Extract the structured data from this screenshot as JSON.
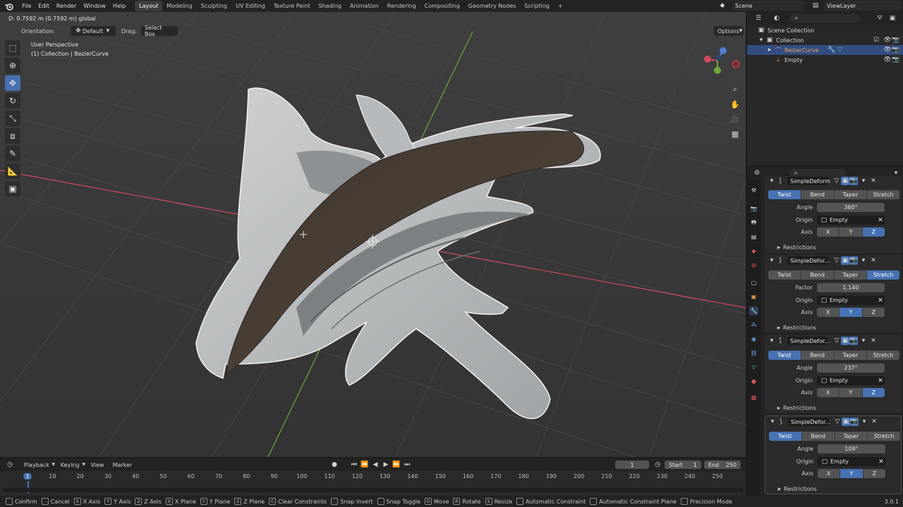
{
  "menu": [
    "File",
    "Edit",
    "Render",
    "Window",
    "Help"
  ],
  "workspaces": [
    {
      "label": "Layout",
      "active": true
    },
    {
      "label": "Modeling",
      "active": false
    },
    {
      "label": "Sculpting",
      "active": false
    },
    {
      "label": "UV Editing",
      "active": false
    },
    {
      "label": "Texture Paint",
      "active": false
    },
    {
      "label": "Shading",
      "active": false
    },
    {
      "label": "Animation",
      "active": false
    },
    {
      "label": "Rendering",
      "active": false
    },
    {
      "label": "Compositing",
      "active": false
    },
    {
      "label": "Geometry Nodes",
      "active": false
    },
    {
      "label": "Scripting",
      "active": false
    }
  ],
  "add_tab": "+",
  "scene_name": "Scene",
  "view_layer": "ViewLayer",
  "viewport": {
    "status_text": "D: 0.7592 m (0.7592 m) global",
    "orientation_label": "Orientation:",
    "orientation_value": "Default",
    "drag_label": "Drag:",
    "drag_value": "Select Box",
    "options": "Options",
    "view_name": "User Perspective",
    "collection_info": "(1) Collection | BezierCurve"
  },
  "outliner": {
    "rows": [
      "Scene Collection",
      "Collection",
      "BezierCurve",
      "Empty"
    ]
  },
  "properties": {
    "modifiers": [
      {
        "name": "SimpleDeform",
        "mode": "Twist",
        "param_label": "Angle",
        "param_value": "360°",
        "origin": "Empty",
        "axis": "Z"
      },
      {
        "name": "SimpleDefor...",
        "mode": "Stretch",
        "param_label": "Factor",
        "param_value": "1.140",
        "origin": "Empty",
        "axis": "Y"
      },
      {
        "name": "SimpleDefor...",
        "mode": "Twist",
        "param_label": "Angle",
        "param_value": "237°",
        "origin": "Empty",
        "axis": "Z"
      },
      {
        "name": "SimpleDefor...",
        "mode": "Twist",
        "param_label": "Angle",
        "param_value": "109°",
        "origin": "Empty",
        "axis": "Y"
      }
    ],
    "modes": [
      "Twist",
      "Bend",
      "Taper",
      "Stretch"
    ],
    "axes": [
      "X",
      "Y",
      "Z"
    ],
    "origin_label": "Origin",
    "axis_label": "Axis",
    "restrictions": "Restrictions"
  },
  "timeline": {
    "menus": [
      "Playback",
      "Keying",
      "View",
      "Marker"
    ],
    "current_frame": "1",
    "start_label": "Start",
    "start_value": "1",
    "end_label": "End",
    "end_value": "250",
    "ruler": [
      "1",
      "10",
      "20",
      "30",
      "40",
      "50",
      "60",
      "70",
      "80",
      "90",
      "100",
      "110",
      "120",
      "130",
      "140",
      "150",
      "160",
      "170",
      "180",
      "190",
      "200",
      "210",
      "220",
      "230",
      "240",
      "250"
    ]
  },
  "statusbar": {
    "items": [
      {
        "key": "",
        "label": "Confirm"
      },
      {
        "key": "",
        "label": "Cancel"
      },
      {
        "key": "X",
        "label": "X Axis"
      },
      {
        "key": "Y",
        "label": "Y Axis"
      },
      {
        "key": "Z",
        "label": "Z Axis"
      },
      {
        "key": "X",
        "label": "X Plane"
      },
      {
        "key": "Y",
        "label": "Y Plane"
      },
      {
        "key": "Z",
        "label": "Z Plane"
      },
      {
        "key": "C",
        "label": "Clear Constraints"
      },
      {
        "key": "",
        "label": "Snap Invert"
      },
      {
        "key": "",
        "label": "Snap Toggle"
      },
      {
        "key": "G",
        "label": "Move"
      },
      {
        "key": "R",
        "label": "Rotate"
      },
      {
        "key": "S",
        "label": "Resize"
      },
      {
        "key": "",
        "label": "Automatic Constraint"
      },
      {
        "key": "",
        "label": "Automatic Constraint Plane"
      },
      {
        "key": "",
        "label": "Precision Mode"
      }
    ],
    "version": "3.0.1"
  },
  "colors": {
    "accent": "#4772b3",
    "selected_row": "#334d80",
    "x_axis": "#d0495e",
    "y_axis": "#6fa83c",
    "outline": "#f0f0f0"
  }
}
